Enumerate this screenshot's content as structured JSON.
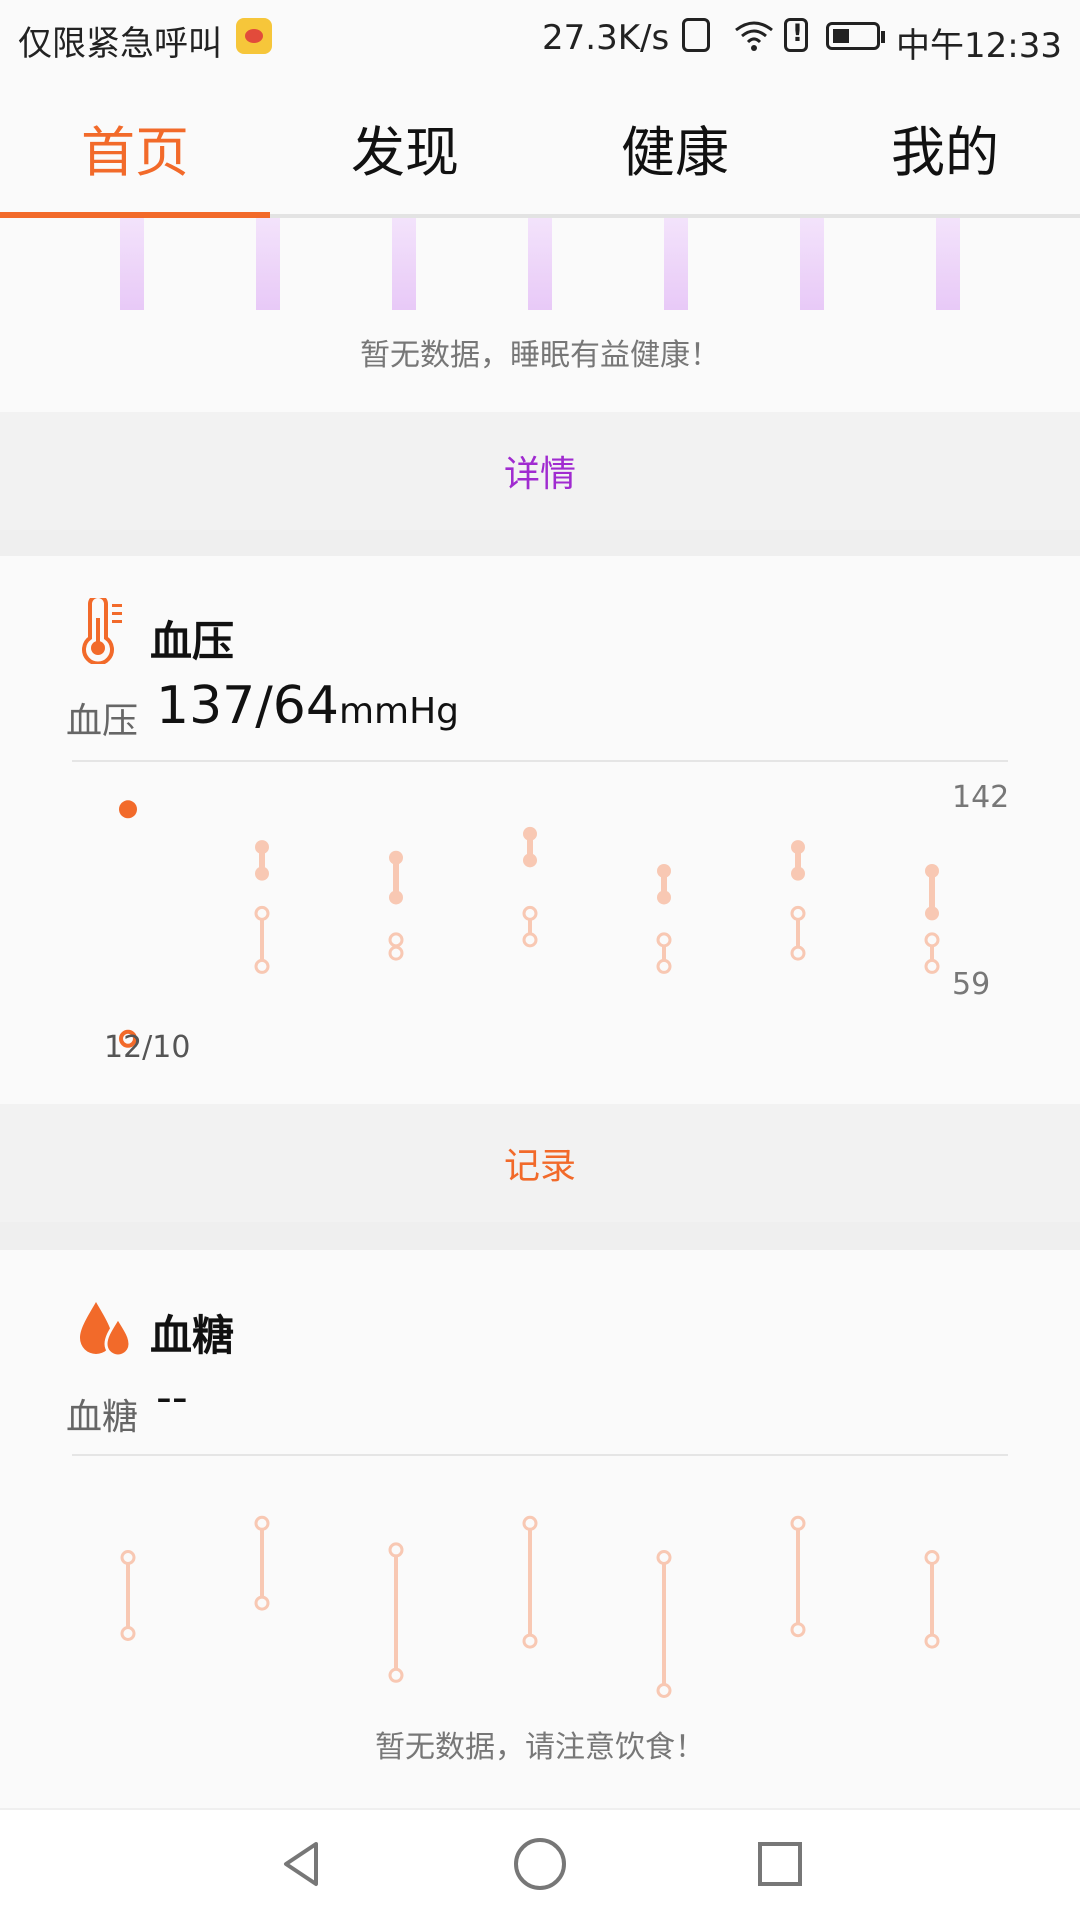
{
  "status_bar": {
    "carrier_text": "仅限紧急呼叫",
    "speed": "27.3K/s",
    "time": "中午12:33"
  },
  "tabs": [
    {
      "label": "首页",
      "active": true
    },
    {
      "label": "发现",
      "active": false
    },
    {
      "label": "健康",
      "active": false
    },
    {
      "label": "我的",
      "active": false
    }
  ],
  "sleep": {
    "empty_text": "暂无数据，睡眠有益健康！",
    "details_button": "详情",
    "bar_count": 7
  },
  "blood_pressure": {
    "title": "血压",
    "metric_label": "血压",
    "value": "137/64",
    "unit": "mmHg",
    "axis_max": "142",
    "axis_min": "59",
    "first_date": "12/10",
    "record_button": "记录",
    "colors": {
      "accent": "#f26a2a",
      "faint": "#f8c8b3"
    },
    "chart_data": {
      "type": "scatter",
      "x": [
        "12/10",
        "",
        "",
        "",
        "",
        "",
        ""
      ],
      "ylim": [
        59,
        142
      ],
      "series": [
        {
          "values": [
            [
              137,
              64
            ]
          ],
          "style": "measured"
        }
      ],
      "placeholder_ranges": [
        [
          [
            128,
            118
          ],
          [
            103,
            83
          ]
        ],
        [
          [
            124,
            109
          ],
          [
            93,
            88
          ]
        ],
        [
          [
            133,
            123
          ],
          [
            103,
            93
          ]
        ],
        [
          [
            119,
            109
          ],
          [
            93,
            83
          ]
        ],
        [
          [
            128,
            118
          ],
          [
            103,
            88
          ]
        ],
        [
          [
            119,
            103
          ],
          [
            93,
            83
          ]
        ]
      ]
    }
  },
  "blood_sugar": {
    "title": "血糖",
    "metric_label": "血糖",
    "value": "--",
    "empty_text": "暂无数据，请注意饮食！",
    "chart_data": {
      "type": "scatter",
      "placeholder_ranges": [
        [
          0.75,
          0.35
        ],
        [
          0.93,
          0.51
        ],
        [
          0.79,
          0.13
        ],
        [
          0.93,
          0.31
        ],
        [
          0.75,
          0.05
        ],
        [
          0.93,
          0.37
        ],
        [
          0.75,
          0.31
        ]
      ]
    }
  },
  "icons": {
    "bp_icon": "thermometer-icon",
    "bg_icon": "droplets-icon"
  }
}
